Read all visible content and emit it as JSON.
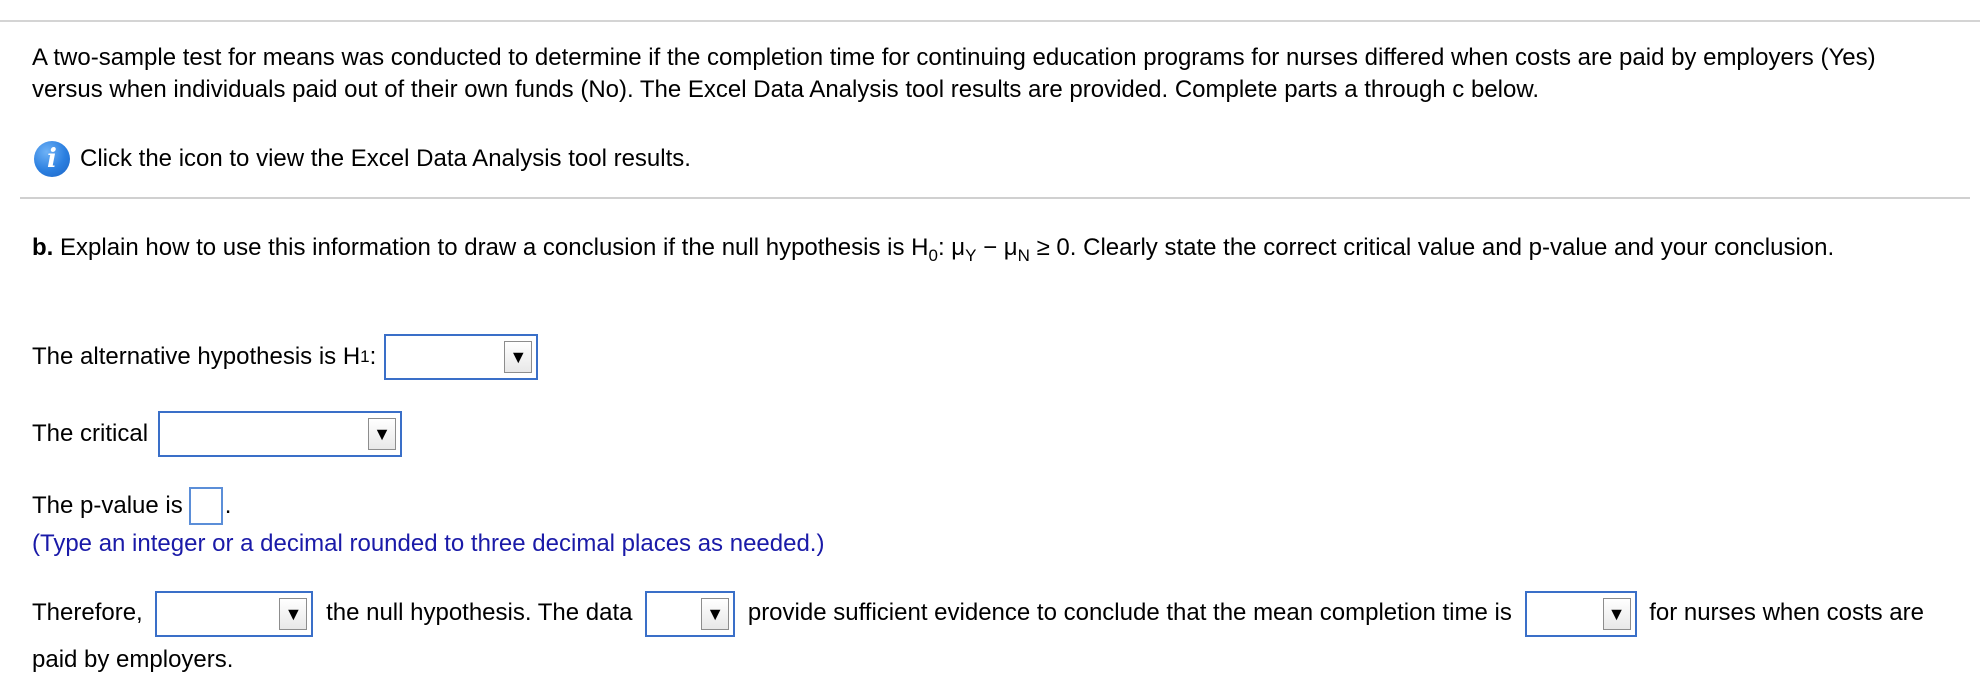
{
  "intro": {
    "text": "A two-sample test for means was conducted to determine if the completion time for continuing education programs for nurses differed when costs are paid by employers (Yes) versus when individuals paid out of their own funds (No). The Excel Data Analysis tool results are provided. Complete parts a through c below."
  },
  "info": {
    "icon": "info-icon",
    "label": "Click the icon to view the Excel Data Analysis tool results."
  },
  "part_b": {
    "label": "b.",
    "text_before": "Explain how to use this information to draw a conclusion if the null hypothesis is ",
    "h0_symbol": "H",
    "h0_sub": "0",
    "expression_mu_y": ": μ",
    "sub_y": "Y",
    "minus_mu": " − μ",
    "sub_n": "N",
    "expression_end": " ≥ 0. Clearly state the correct critical value and p-value and your conclusion."
  },
  "alt_hypothesis": {
    "prefix": "The alternative hypothesis is H",
    "sub": "1",
    "suffix": ":",
    "selected": ""
  },
  "critical": {
    "prefix": "The critical",
    "selected": ""
  },
  "pvalue": {
    "prefix": "The p-value is",
    "value": "",
    "suffix": ".",
    "hint": "(Type an integer or a decimal rounded to three decimal places as needed.)"
  },
  "conclusion": {
    "part1": "Therefore,",
    "part2": "the null hypothesis. The data",
    "part3": "provide sufficient evidence to conclude that the mean completion time is",
    "part4": "for nurses when costs are paid by employers.",
    "dropdown1": "",
    "dropdown2": "",
    "dropdown3": ""
  },
  "dropdown_arrow": "▼",
  "colors": {
    "accent_border": "#3a6fc8",
    "hint_text": "#1a1aa8",
    "info_icon": "#2b7fe0"
  }
}
